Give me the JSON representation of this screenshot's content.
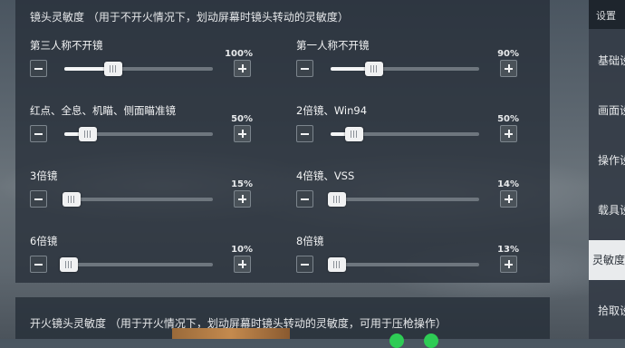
{
  "section_title": "镜头灵敏度  （用于不开火情况下，划动屏幕时镜头转动的灵敏度）",
  "section2_title": "开火镜头灵敏度 （用于开火情况下，划动屏幕时镜头转动的灵敏度，可用于压枪操作）",
  "sliders": [
    {
      "label": "第三人称不开镜",
      "percent_text": "100%",
      "value": 0.33
    },
    {
      "label": "第一人称不开镜",
      "percent_text": "90%",
      "value": 0.29
    },
    {
      "label": "红点、全息、机瞄、侧面瞄准镜",
      "percent_text": "50%",
      "value": 0.16
    },
    {
      "label": "2倍镜、Win94",
      "percent_text": "50%",
      "value": 0.16
    },
    {
      "label": "3倍镜",
      "percent_text": "15%",
      "value": 0.05
    },
    {
      "label": "4倍镜、VSS",
      "percent_text": "14%",
      "value": 0.045
    },
    {
      "label": "6倍镜",
      "percent_text": "10%",
      "value": 0.03
    },
    {
      "label": "8倍镜",
      "percent_text": "13%",
      "value": 0.04
    }
  ],
  "sidebar": {
    "header": "设置",
    "items": [
      {
        "label": "基础设置"
      },
      {
        "label": "画面设置"
      },
      {
        "label": "操作设置"
      },
      {
        "label": "载具设置"
      },
      {
        "label": "灵敏度设置",
        "active": true
      },
      {
        "label": "拾取设置"
      }
    ]
  }
}
